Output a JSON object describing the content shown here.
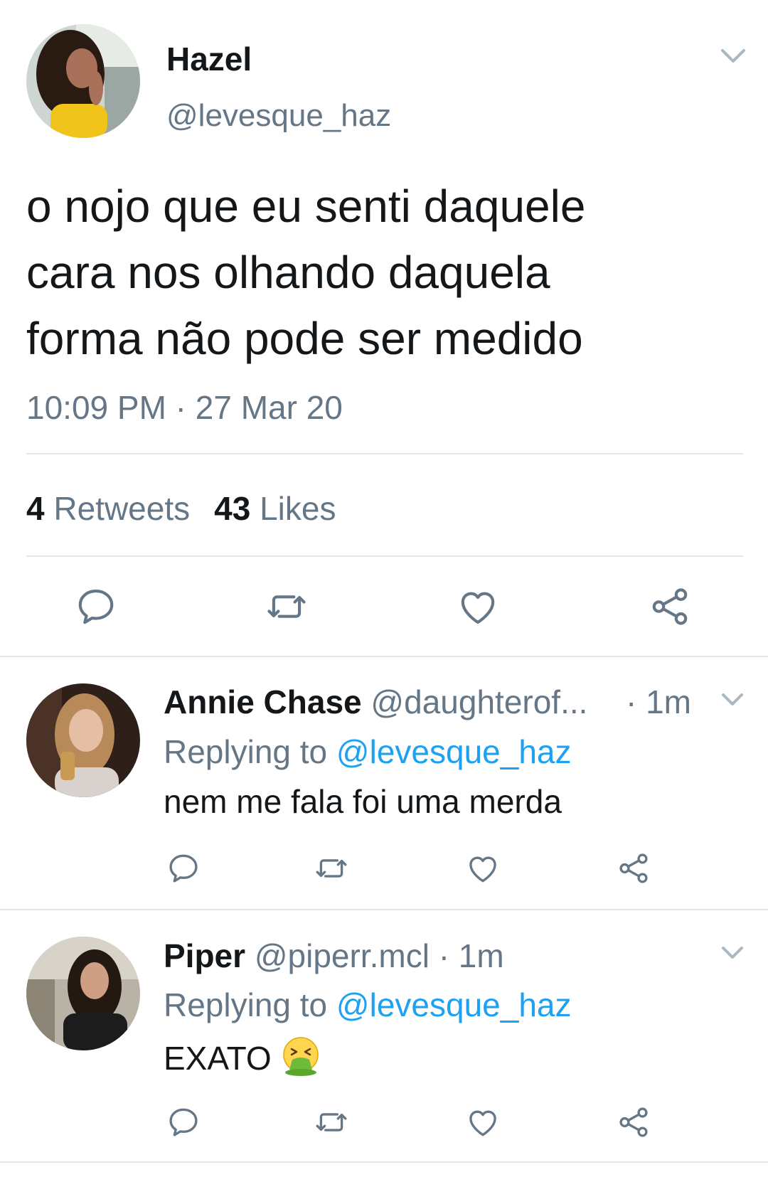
{
  "main_tweet": {
    "name": "Hazel",
    "handle": "@levesque_haz",
    "text": "o nojo que eu senti daquele\ncara nos olhando daquela\nforma não pode ser medido",
    "timestamp": "10:09 PM · 27 Mar 20",
    "retweet_count": "4",
    "retweet_label": "Retweets",
    "like_count": "43",
    "like_label": "Likes"
  },
  "replies": [
    {
      "name": "Annie Chase",
      "handle": "@daughterof...",
      "time": "· 1m",
      "replying_label": "Replying to",
      "replying_to": "@levesque_haz",
      "text": "nem me fala foi uma merda"
    },
    {
      "name": "Piper",
      "handle": "@piperr.mcl",
      "time": "· 1m",
      "replying_label": "Replying to",
      "replying_to": "@levesque_haz",
      "text": "EXATO",
      "emoji": "face-vomiting"
    }
  ],
  "icons": {
    "reply": "comment-bubble-icon",
    "retweet": "retweet-icon",
    "like": "heart-icon",
    "share": "share-icon",
    "menu": "chevron-down-icon"
  },
  "colors": {
    "text_primary": "#14171a",
    "text_secondary": "#657786",
    "link": "#1da1f2",
    "divider": "#e1e8ed"
  }
}
